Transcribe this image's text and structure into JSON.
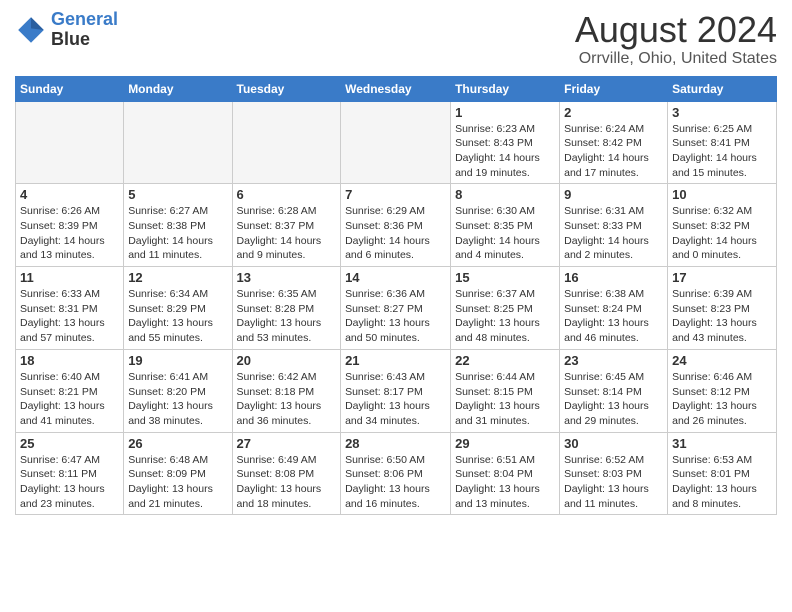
{
  "header": {
    "logo_line1": "General",
    "logo_line2": "Blue",
    "main_title": "August 2024",
    "subtitle": "Orrville, Ohio, United States"
  },
  "days_of_week": [
    "Sunday",
    "Monday",
    "Tuesday",
    "Wednesday",
    "Thursday",
    "Friday",
    "Saturday"
  ],
  "weeks": [
    [
      {
        "day": "",
        "info": "",
        "empty": true
      },
      {
        "day": "",
        "info": "",
        "empty": true
      },
      {
        "day": "",
        "info": "",
        "empty": true
      },
      {
        "day": "",
        "info": "",
        "empty": true
      },
      {
        "day": "1",
        "info": "Sunrise: 6:23 AM\nSunset: 8:43 PM\nDaylight: 14 hours\nand 19 minutes."
      },
      {
        "day": "2",
        "info": "Sunrise: 6:24 AM\nSunset: 8:42 PM\nDaylight: 14 hours\nand 17 minutes."
      },
      {
        "day": "3",
        "info": "Sunrise: 6:25 AM\nSunset: 8:41 PM\nDaylight: 14 hours\nand 15 minutes."
      }
    ],
    [
      {
        "day": "4",
        "info": "Sunrise: 6:26 AM\nSunset: 8:39 PM\nDaylight: 14 hours\nand 13 minutes."
      },
      {
        "day": "5",
        "info": "Sunrise: 6:27 AM\nSunset: 8:38 PM\nDaylight: 14 hours\nand 11 minutes."
      },
      {
        "day": "6",
        "info": "Sunrise: 6:28 AM\nSunset: 8:37 PM\nDaylight: 14 hours\nand 9 minutes."
      },
      {
        "day": "7",
        "info": "Sunrise: 6:29 AM\nSunset: 8:36 PM\nDaylight: 14 hours\nand 6 minutes."
      },
      {
        "day": "8",
        "info": "Sunrise: 6:30 AM\nSunset: 8:35 PM\nDaylight: 14 hours\nand 4 minutes."
      },
      {
        "day": "9",
        "info": "Sunrise: 6:31 AM\nSunset: 8:33 PM\nDaylight: 14 hours\nand 2 minutes."
      },
      {
        "day": "10",
        "info": "Sunrise: 6:32 AM\nSunset: 8:32 PM\nDaylight: 14 hours\nand 0 minutes."
      }
    ],
    [
      {
        "day": "11",
        "info": "Sunrise: 6:33 AM\nSunset: 8:31 PM\nDaylight: 13 hours\nand 57 minutes."
      },
      {
        "day": "12",
        "info": "Sunrise: 6:34 AM\nSunset: 8:29 PM\nDaylight: 13 hours\nand 55 minutes."
      },
      {
        "day": "13",
        "info": "Sunrise: 6:35 AM\nSunset: 8:28 PM\nDaylight: 13 hours\nand 53 minutes."
      },
      {
        "day": "14",
        "info": "Sunrise: 6:36 AM\nSunset: 8:27 PM\nDaylight: 13 hours\nand 50 minutes."
      },
      {
        "day": "15",
        "info": "Sunrise: 6:37 AM\nSunset: 8:25 PM\nDaylight: 13 hours\nand 48 minutes."
      },
      {
        "day": "16",
        "info": "Sunrise: 6:38 AM\nSunset: 8:24 PM\nDaylight: 13 hours\nand 46 minutes."
      },
      {
        "day": "17",
        "info": "Sunrise: 6:39 AM\nSunset: 8:23 PM\nDaylight: 13 hours\nand 43 minutes."
      }
    ],
    [
      {
        "day": "18",
        "info": "Sunrise: 6:40 AM\nSunset: 8:21 PM\nDaylight: 13 hours\nand 41 minutes."
      },
      {
        "day": "19",
        "info": "Sunrise: 6:41 AM\nSunset: 8:20 PM\nDaylight: 13 hours\nand 38 minutes."
      },
      {
        "day": "20",
        "info": "Sunrise: 6:42 AM\nSunset: 8:18 PM\nDaylight: 13 hours\nand 36 minutes."
      },
      {
        "day": "21",
        "info": "Sunrise: 6:43 AM\nSunset: 8:17 PM\nDaylight: 13 hours\nand 34 minutes."
      },
      {
        "day": "22",
        "info": "Sunrise: 6:44 AM\nSunset: 8:15 PM\nDaylight: 13 hours\nand 31 minutes."
      },
      {
        "day": "23",
        "info": "Sunrise: 6:45 AM\nSunset: 8:14 PM\nDaylight: 13 hours\nand 29 minutes."
      },
      {
        "day": "24",
        "info": "Sunrise: 6:46 AM\nSunset: 8:12 PM\nDaylight: 13 hours\nand 26 minutes."
      }
    ],
    [
      {
        "day": "25",
        "info": "Sunrise: 6:47 AM\nSunset: 8:11 PM\nDaylight: 13 hours\nand 23 minutes."
      },
      {
        "day": "26",
        "info": "Sunrise: 6:48 AM\nSunset: 8:09 PM\nDaylight: 13 hours\nand 21 minutes."
      },
      {
        "day": "27",
        "info": "Sunrise: 6:49 AM\nSunset: 8:08 PM\nDaylight: 13 hours\nand 18 minutes."
      },
      {
        "day": "28",
        "info": "Sunrise: 6:50 AM\nSunset: 8:06 PM\nDaylight: 13 hours\nand 16 minutes."
      },
      {
        "day": "29",
        "info": "Sunrise: 6:51 AM\nSunset: 8:04 PM\nDaylight: 13 hours\nand 13 minutes."
      },
      {
        "day": "30",
        "info": "Sunrise: 6:52 AM\nSunset: 8:03 PM\nDaylight: 13 hours\nand 11 minutes."
      },
      {
        "day": "31",
        "info": "Sunrise: 6:53 AM\nSunset: 8:01 PM\nDaylight: 13 hours\nand 8 minutes."
      }
    ]
  ]
}
